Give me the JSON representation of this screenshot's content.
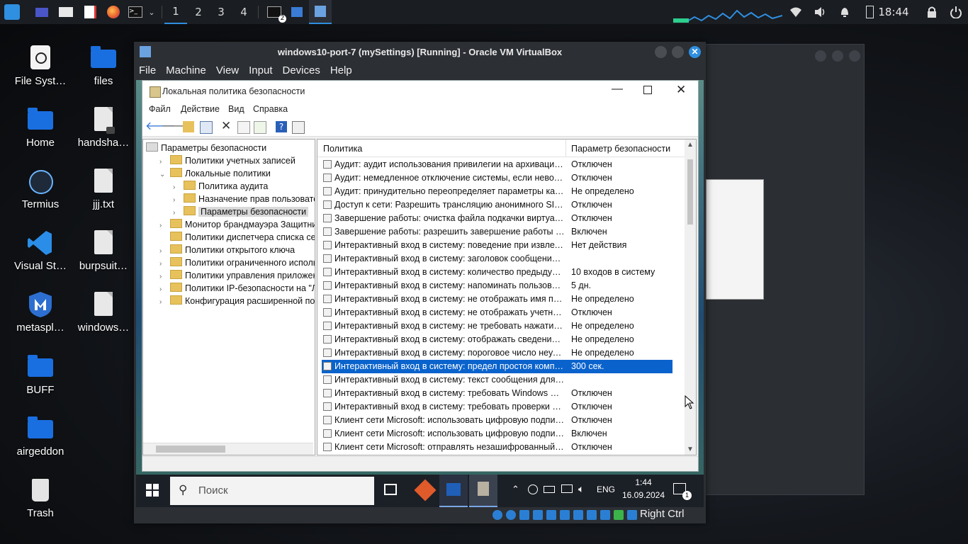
{
  "top_panel": {
    "workspaces": [
      "1",
      "2",
      "3",
      "4"
    ],
    "clock": "18:44",
    "terminal_badge": "2"
  },
  "desktop": {
    "icons": [
      {
        "label": "File Syst…",
        "kind": "app"
      },
      {
        "label": "files",
        "kind": "folder"
      },
      {
        "label": "Home",
        "kind": "folder"
      },
      {
        "label": "handsha…",
        "kind": "file-locked"
      },
      {
        "label": "Termius",
        "kind": "app"
      },
      {
        "label": "jjj.txt",
        "kind": "file"
      },
      {
        "label": "Visual St…",
        "kind": "app"
      },
      {
        "label": "burpsuit…",
        "kind": "file"
      },
      {
        "label": "metaspl…",
        "kind": "app"
      },
      {
        "label": "windows…",
        "kind": "file"
      },
      {
        "label": "BUFF",
        "kind": "folder"
      },
      {
        "label": "airgeddon",
        "kind": "folder"
      },
      {
        "label": "Trash",
        "kind": "trash"
      }
    ]
  },
  "vbox": {
    "title": "windows10-port-7 (mySettings) [Running] - Oracle VM VirtualBox",
    "menu": [
      "File",
      "Machine",
      "View",
      "Input",
      "Devices",
      "Help"
    ],
    "host_key": "Right Ctrl"
  },
  "mmc": {
    "title": "Локальная политика безопасности",
    "menu": [
      "Файл",
      "Действие",
      "Вид",
      "Справка"
    ],
    "tree": [
      {
        "label": "Параметры безопасности",
        "level": 0,
        "arrow": "",
        "selected": false
      },
      {
        "label": "Политики учетных записей",
        "level": 1,
        "arrow": "›",
        "selected": false
      },
      {
        "label": "Локальные политики",
        "level": 1,
        "arrow": "⌄",
        "selected": false
      },
      {
        "label": "Политика аудита",
        "level": 2,
        "arrow": "›",
        "selected": false
      },
      {
        "label": "Назначение прав пользователя",
        "level": 2,
        "arrow": "›",
        "selected": false
      },
      {
        "label": "Параметры безопасности",
        "level": 2,
        "arrow": "›",
        "selected": true
      },
      {
        "label": "Монитор брандмауэра Защитника W",
        "level": 1,
        "arrow": "›",
        "selected": false
      },
      {
        "label": "Политики диспетчера списка сетей",
        "level": 1,
        "arrow": "",
        "selected": false
      },
      {
        "label": "Политики открытого ключа",
        "level": 1,
        "arrow": "›",
        "selected": false
      },
      {
        "label": "Политики ограниченного использо",
        "level": 1,
        "arrow": "›",
        "selected": false
      },
      {
        "label": "Политики управления приложения",
        "level": 1,
        "arrow": "›",
        "selected": false
      },
      {
        "label": "Политики IP-безопасности на \"Лока",
        "level": 1,
        "arrow": "›",
        "selected": false
      },
      {
        "label": "Конфигурация расширенной полит",
        "level": 1,
        "arrow": "›",
        "selected": false
      }
    ],
    "columns": {
      "policy": "Политика",
      "setting": "Параметр безопасности"
    },
    "rows": [
      {
        "policy": "Аудит: аудит использования привилегии на архивацию и...",
        "setting": "Отключен"
      },
      {
        "policy": "Аудит: немедленное отключение системы, если невозмо...",
        "setting": "Отключен"
      },
      {
        "policy": "Аудит: принудительно переопределяет параметры катег...",
        "setting": "Не определено"
      },
      {
        "policy": "Доступ к сети: Разрешить трансляцию анонимного SID в ...",
        "setting": "Отключен"
      },
      {
        "policy": "Завершение работы: очистка файла подкачки виртуальн...",
        "setting": "Отключен"
      },
      {
        "policy": "Завершение работы: разрешить завершение работы сис...",
        "setting": "Включен"
      },
      {
        "policy": "Интерактивный вход в систему:  поведение при извлечен...",
        "setting": "Нет действия"
      },
      {
        "policy": "Интерактивный вход в систему: заголовок сообщения дл...",
        "setting": ""
      },
      {
        "policy": "Интерактивный вход в систему: количество предыдущих...",
        "setting": "10 входов в систему"
      },
      {
        "policy": "Интерактивный вход в систему: напоминать пользовател...",
        "setting": "5 дн."
      },
      {
        "policy": "Интерактивный вход в систему: не отображать имя поль...",
        "setting": "Не определено"
      },
      {
        "policy": "Интерактивный вход в систему: не отображать учетные д...",
        "setting": "Отключен"
      },
      {
        "policy": "Интерактивный вход в систему: не требовать нажатия CT...",
        "setting": "Не определено"
      },
      {
        "policy": "Интерактивный вход в систему: отображать сведения о п...",
        "setting": "Не определено"
      },
      {
        "policy": "Интерактивный вход в систему: пороговое число неудач...",
        "setting": "Не определено"
      },
      {
        "policy": "Интерактивный вход в систему: предел простоя компью...",
        "setting": "300 сек.",
        "selected": true
      },
      {
        "policy": "Интерактивный вход в систему: текст сообщения для по...",
        "setting": ""
      },
      {
        "policy": "Интерактивный вход в систему: требовать Windows Hello...",
        "setting": "Отключен"
      },
      {
        "policy": "Интерактивный вход в систему: требовать проверки на к...",
        "setting": "Отключен"
      },
      {
        "policy": "Клиент сети Microsoft: использовать цифровую подпись ...",
        "setting": "Отключен"
      },
      {
        "policy": "Клиент сети Microsoft: использовать цифровую подпись ...",
        "setting": "Включен"
      },
      {
        "policy": "Клиент сети Microsoft: отправлять незашифрованный па...",
        "setting": "Отключен"
      }
    ]
  },
  "win_taskbar": {
    "search_placeholder": "Поиск",
    "lang": "ENG",
    "time": "1:44",
    "date": "16.09.2024",
    "notif_count": "1"
  },
  "colors": {
    "accent": "#2f8fe0",
    "selection": "#0a63cc",
    "folder": "#1a6fe0"
  }
}
